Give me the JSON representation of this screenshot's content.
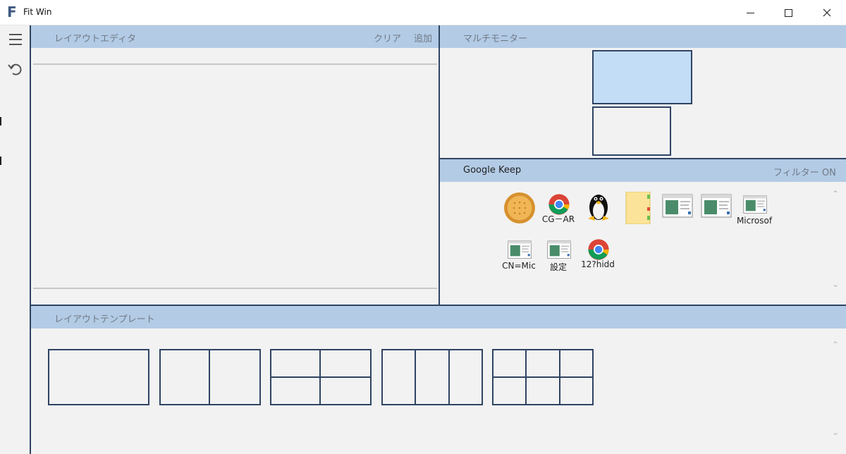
{
  "window": {
    "app_letter": "F",
    "title": "Fit Win"
  },
  "editor": {
    "title": "レイアウトエディタ",
    "clear_label": "クリア",
    "add_label": "追加"
  },
  "monitors": {
    "title": "マルチモニター"
  },
  "keep": {
    "title": "Google Keep",
    "filter_label": "フィルター ON",
    "apps": [
      {
        "icon": "cookie-icon",
        "label": ""
      },
      {
        "icon": "chrome-icon",
        "label": "CG－AR"
      },
      {
        "icon": "linux-penguin-icon",
        "label": ""
      },
      {
        "icon": "notebook-icon",
        "label": ""
      },
      {
        "icon": "window-app-icon",
        "label": ""
      },
      {
        "icon": "window-app-icon",
        "label": ""
      },
      {
        "icon": "window-app-icon",
        "label": "Microsof"
      },
      {
        "icon": "window-app-icon",
        "label": "CN=Mic"
      },
      {
        "icon": "window-app-icon",
        "label": "設定"
      },
      {
        "icon": "chrome-icon",
        "label": "12?hidd"
      }
    ]
  },
  "templates": {
    "title": "レイアウトテンプレート",
    "items": [
      {
        "name": "single",
        "cols": 1,
        "rows": 1
      },
      {
        "name": "two-columns",
        "cols": 2,
        "rows": 1
      },
      {
        "name": "two-by-two",
        "cols": 2,
        "rows": 2
      },
      {
        "name": "three-columns",
        "cols": 3,
        "rows": 1
      },
      {
        "name": "three-by-two",
        "cols": 3,
        "rows": 2
      }
    ]
  },
  "colors": {
    "accent": "#2f4463",
    "header": "#b3cbe5",
    "monitor_active": "#c3ddf6",
    "panel_bg": "#f2f2f2"
  }
}
